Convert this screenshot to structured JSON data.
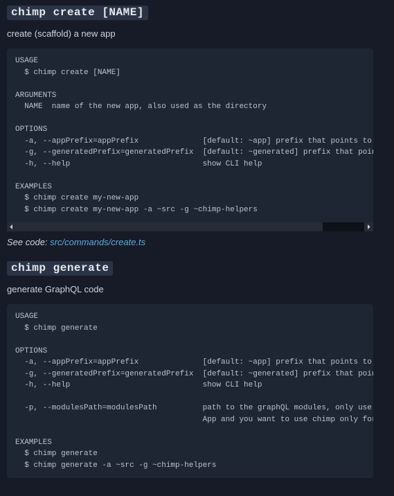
{
  "section1": {
    "heading": "chimp create [NAME]",
    "desc": "create (scaffold) a new app",
    "code": "USAGE\n  $ chimp create [NAME]\n\nARGUMENTS\n  NAME  name of the new app, also used as the directory\n\nOPTIONS\n  -a, --appPrefix=appPrefix              [default: ~app] prefix that points to the sourcecode of your app\n  -g, --generatedPrefix=generatedPrefix  [default: ~generated] prefix that points to the generated by chimp h\n  -h, --help                             show CLI help\n\nEXAMPLES\n  $ chimp create my-new-app\n  $ chimp create my-new-app -a ~src -g ~chimp-helpers",
    "seecode_prefix": "See code: ",
    "seecode_link": "src/commands/create.ts"
  },
  "section2": {
    "heading": "chimp generate",
    "desc": "generate GraphQL code",
    "code": "USAGE\n  $ chimp generate\n\nOPTIONS\n  -a, --appPrefix=appPrefix              [default: ~app] prefix that points to the sourcecode of your app\n  -g, --generatedPrefix=generatedPrefix  [default: ~generated] prefix that points to the generated by chimp h\n  -h, --help                             show CLI help\n\n  -p, --modulesPath=modulesPath          path to the graphQL modules, only use if you are migrating an existi\n                                         App and you want to use chimp only for a part of it\n\nEXAMPLES\n  $ chimp generate\n  $ chimp generate -a ~src -g ~chimp-helpers"
  }
}
